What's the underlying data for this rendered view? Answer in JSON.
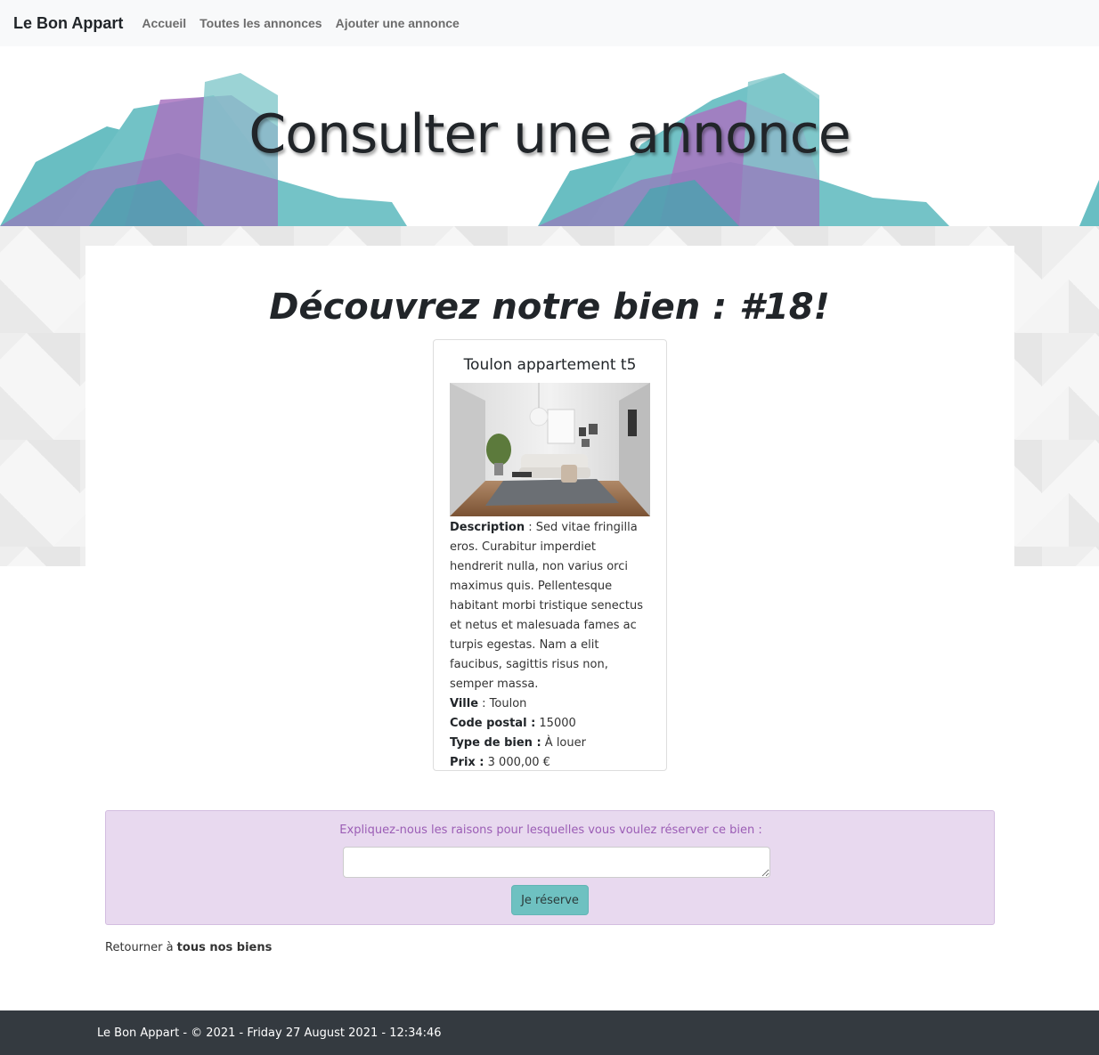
{
  "navbar": {
    "brand": "Le Bon Appart",
    "links": [
      "Accueil",
      "Toutes les annonces",
      "Ajouter une annonce"
    ]
  },
  "hero": {
    "title": "Consulter une annonce"
  },
  "main": {
    "heading": "Découvrez notre bien : #18!"
  },
  "card": {
    "title": "Toulon appartement t5",
    "image_alt": "living-room-photo",
    "description_label": "Description",
    "description_value": " : Sed vitae fringilla eros. Curabitur imperdiet hendrerit nulla, non varius orci maximus quis. Pellentesque habitant morbi tristique senectus et netus et malesuada fames ac turpis egestas. Nam a elit faucibus, sagittis risus non, semper massa.",
    "city_label": "Ville",
    "city_value": " : Toulon",
    "postcode_label": "Code postal :",
    "postcode_value": " 15000",
    "type_label": "Type de bien :",
    "type_value": " À louer",
    "price_label": "Prix :",
    "price_value": " 3 000,00 €"
  },
  "reservation": {
    "label": "Expliquez-nous les raisons pour lesquelles vous voulez réserver ce bien :",
    "textarea_value": "",
    "button_label": "Je réserve"
  },
  "back": {
    "prefix": "Retourner à ",
    "link": "tous nos biens"
  },
  "footer": {
    "text": "Le Bon Appart - © 2021 - Friday 27 August 2021 - 12:34:46"
  },
  "colors": {
    "accent_teal": "#6ec1c1",
    "accent_purple": "#9b5db5",
    "reserve_bg": "#e8d9ef",
    "footer_bg": "#343a40"
  }
}
